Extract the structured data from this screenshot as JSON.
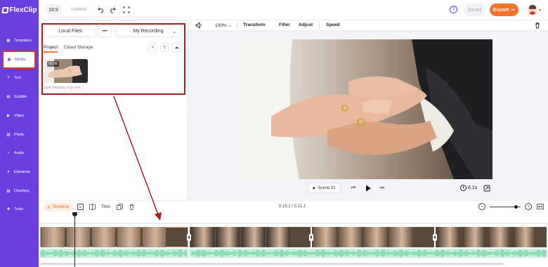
{
  "app": {
    "brand": "FlexClip"
  },
  "topbar": {
    "aspect_ratio": "16:9",
    "project_title": "Untitled",
    "saved_label": "Saved",
    "export_label": "Export"
  },
  "sidebar": {
    "items": [
      {
        "label": "Templates",
        "icon": "templates-icon"
      },
      {
        "label": "Media",
        "icon": "media-icon",
        "active": true
      },
      {
        "label": "Text",
        "icon": "text-icon"
      },
      {
        "label": "Subtitle",
        "icon": "subtitle-icon"
      },
      {
        "label": "Video",
        "icon": "video-icon"
      },
      {
        "label": "Photo",
        "icon": "photo-icon"
      },
      {
        "label": "Audio",
        "icon": "audio-icon"
      },
      {
        "label": "Elements",
        "icon": "elements-icon"
      },
      {
        "label": "Overlays",
        "icon": "overlays-icon"
      },
      {
        "label": "Tools",
        "icon": "tools-icon"
      }
    ]
  },
  "media_panel": {
    "local_files_label": "Local Files",
    "more_label": "•••",
    "recording_label": "My Recording",
    "tabs": [
      "Project",
      "Cloud Storage"
    ],
    "items": [
      {
        "duration": "00:06",
        "caption": "gold wedding rings and ..."
      }
    ]
  },
  "toolbar": {
    "zoom": "100%",
    "items": [
      "Transform",
      "Filter",
      "Adjust",
      "Speed"
    ]
  },
  "player": {
    "scene_label": "Scene 01",
    "duration": "6.1s"
  },
  "timeline": {
    "label": "Timeline",
    "trim_label": "Trim",
    "timecode": "0:15.1 / 0:21.1",
    "zoom_level": 0.85
  },
  "colors": {
    "brand": "#6a3fe0",
    "export": "#f4722b",
    "highlight": "#a41e1e",
    "audio": "#c7f0dc"
  }
}
